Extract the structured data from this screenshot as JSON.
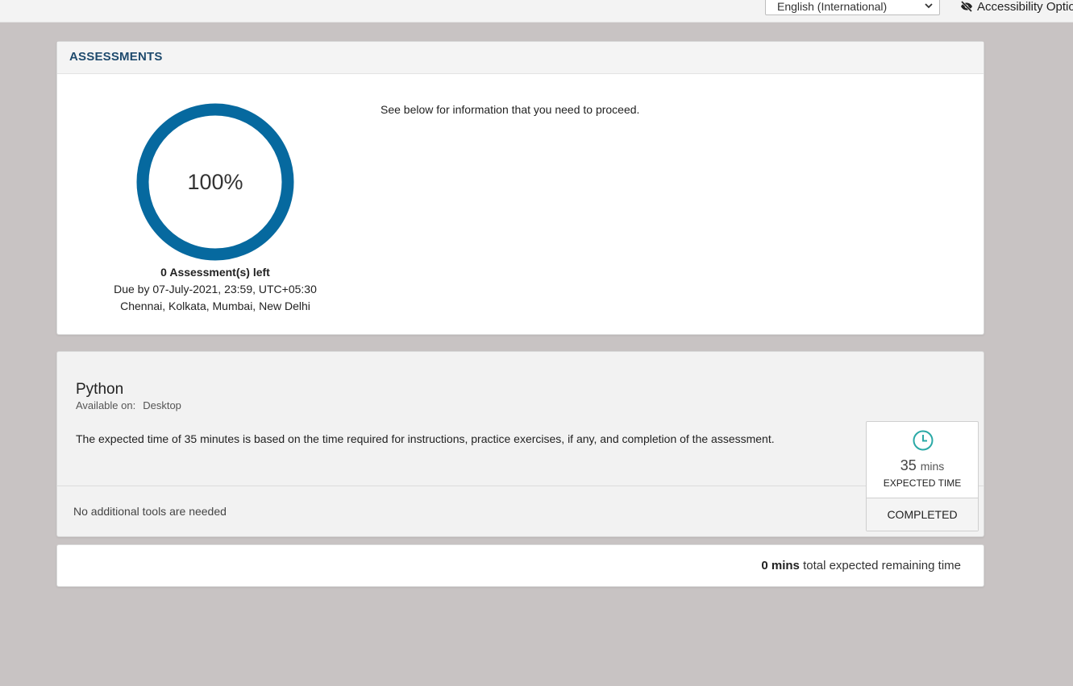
{
  "topbar": {
    "language": "English (International)",
    "accessibility_label": "Accessibility Optio"
  },
  "assessments": {
    "header": "ASSESSMENTS",
    "progress_percent_label": "100%",
    "progress_fraction": 1.0,
    "left_count": "0 Assessment(s) left",
    "due": "Due by 07-July-2021, 23:59, UTC+05:30",
    "timezone_cities": "Chennai, Kolkata, Mumbai, New Delhi",
    "proceed_text": "See below for information that you need to proceed."
  },
  "python": {
    "title": "Python",
    "available_label": "Available on:",
    "available_value": "Desktop",
    "description": "The expected time of 35 minutes is based on the time required for instructions, practice exercises, if any, and completion of the assessment.",
    "tools": "No additional tools are needed",
    "time_value": "35",
    "time_unit": "mins",
    "time_label": "EXPECTED TIME",
    "status": "COMPLETED"
  },
  "remaining": {
    "mins": "0 mins",
    "suffix": "total expected remaining time"
  },
  "colors": {
    "progress_ring": "#06699f",
    "header_text": "#1e4a6d",
    "clock_icon": "#2aa9a6"
  },
  "icons": {
    "accessibility": "eye-slash-icon",
    "clock": "clock-icon",
    "select": "chevron-down-icon"
  }
}
